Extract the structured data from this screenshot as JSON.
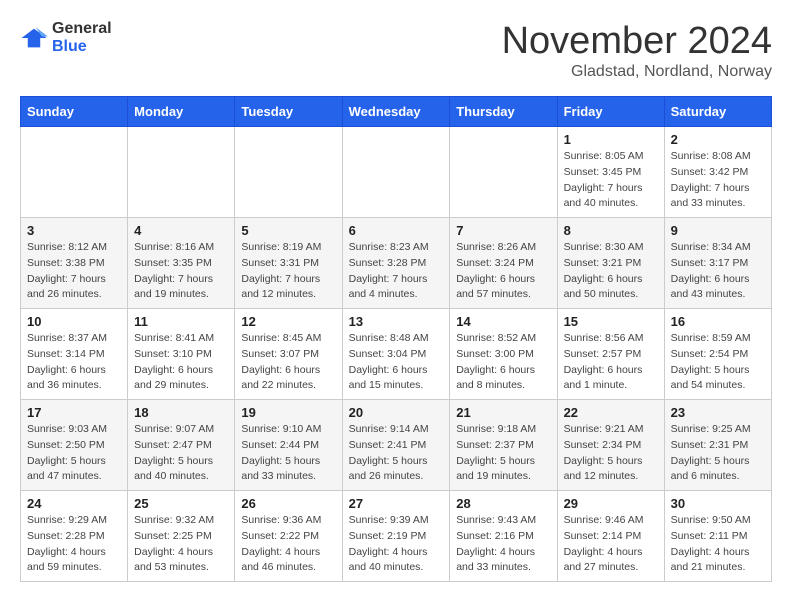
{
  "logo": {
    "text_general": "General",
    "text_blue": "Blue"
  },
  "title": "November 2024",
  "subtitle": "Gladstad, Nordland, Norway",
  "days_of_week": [
    "Sunday",
    "Monday",
    "Tuesday",
    "Wednesday",
    "Thursday",
    "Friday",
    "Saturday"
  ],
  "weeks": [
    [
      {
        "day": "",
        "info": ""
      },
      {
        "day": "",
        "info": ""
      },
      {
        "day": "",
        "info": ""
      },
      {
        "day": "",
        "info": ""
      },
      {
        "day": "",
        "info": ""
      },
      {
        "day": "1",
        "info": "Sunrise: 8:05 AM\nSunset: 3:45 PM\nDaylight: 7 hours and 40 minutes."
      },
      {
        "day": "2",
        "info": "Sunrise: 8:08 AM\nSunset: 3:42 PM\nDaylight: 7 hours and 33 minutes."
      }
    ],
    [
      {
        "day": "3",
        "info": "Sunrise: 8:12 AM\nSunset: 3:38 PM\nDaylight: 7 hours and 26 minutes."
      },
      {
        "day": "4",
        "info": "Sunrise: 8:16 AM\nSunset: 3:35 PM\nDaylight: 7 hours and 19 minutes."
      },
      {
        "day": "5",
        "info": "Sunrise: 8:19 AM\nSunset: 3:31 PM\nDaylight: 7 hours and 12 minutes."
      },
      {
        "day": "6",
        "info": "Sunrise: 8:23 AM\nSunset: 3:28 PM\nDaylight: 7 hours and 4 minutes."
      },
      {
        "day": "7",
        "info": "Sunrise: 8:26 AM\nSunset: 3:24 PM\nDaylight: 6 hours and 57 minutes."
      },
      {
        "day": "8",
        "info": "Sunrise: 8:30 AM\nSunset: 3:21 PM\nDaylight: 6 hours and 50 minutes."
      },
      {
        "day": "9",
        "info": "Sunrise: 8:34 AM\nSunset: 3:17 PM\nDaylight: 6 hours and 43 minutes."
      }
    ],
    [
      {
        "day": "10",
        "info": "Sunrise: 8:37 AM\nSunset: 3:14 PM\nDaylight: 6 hours and 36 minutes."
      },
      {
        "day": "11",
        "info": "Sunrise: 8:41 AM\nSunset: 3:10 PM\nDaylight: 6 hours and 29 minutes."
      },
      {
        "day": "12",
        "info": "Sunrise: 8:45 AM\nSunset: 3:07 PM\nDaylight: 6 hours and 22 minutes."
      },
      {
        "day": "13",
        "info": "Sunrise: 8:48 AM\nSunset: 3:04 PM\nDaylight: 6 hours and 15 minutes."
      },
      {
        "day": "14",
        "info": "Sunrise: 8:52 AM\nSunset: 3:00 PM\nDaylight: 6 hours and 8 minutes."
      },
      {
        "day": "15",
        "info": "Sunrise: 8:56 AM\nSunset: 2:57 PM\nDaylight: 6 hours and 1 minute."
      },
      {
        "day": "16",
        "info": "Sunrise: 8:59 AM\nSunset: 2:54 PM\nDaylight: 5 hours and 54 minutes."
      }
    ],
    [
      {
        "day": "17",
        "info": "Sunrise: 9:03 AM\nSunset: 2:50 PM\nDaylight: 5 hours and 47 minutes."
      },
      {
        "day": "18",
        "info": "Sunrise: 9:07 AM\nSunset: 2:47 PM\nDaylight: 5 hours and 40 minutes."
      },
      {
        "day": "19",
        "info": "Sunrise: 9:10 AM\nSunset: 2:44 PM\nDaylight: 5 hours and 33 minutes."
      },
      {
        "day": "20",
        "info": "Sunrise: 9:14 AM\nSunset: 2:41 PM\nDaylight: 5 hours and 26 minutes."
      },
      {
        "day": "21",
        "info": "Sunrise: 9:18 AM\nSunset: 2:37 PM\nDaylight: 5 hours and 19 minutes."
      },
      {
        "day": "22",
        "info": "Sunrise: 9:21 AM\nSunset: 2:34 PM\nDaylight: 5 hours and 12 minutes."
      },
      {
        "day": "23",
        "info": "Sunrise: 9:25 AM\nSunset: 2:31 PM\nDaylight: 5 hours and 6 minutes."
      }
    ],
    [
      {
        "day": "24",
        "info": "Sunrise: 9:29 AM\nSunset: 2:28 PM\nDaylight: 4 hours and 59 minutes."
      },
      {
        "day": "25",
        "info": "Sunrise: 9:32 AM\nSunset: 2:25 PM\nDaylight: 4 hours and 53 minutes."
      },
      {
        "day": "26",
        "info": "Sunrise: 9:36 AM\nSunset: 2:22 PM\nDaylight: 4 hours and 46 minutes."
      },
      {
        "day": "27",
        "info": "Sunrise: 9:39 AM\nSunset: 2:19 PM\nDaylight: 4 hours and 40 minutes."
      },
      {
        "day": "28",
        "info": "Sunrise: 9:43 AM\nSunset: 2:16 PM\nDaylight: 4 hours and 33 minutes."
      },
      {
        "day": "29",
        "info": "Sunrise: 9:46 AM\nSunset: 2:14 PM\nDaylight: 4 hours and 27 minutes."
      },
      {
        "day": "30",
        "info": "Sunrise: 9:50 AM\nSunset: 2:11 PM\nDaylight: 4 hours and 21 minutes."
      }
    ]
  ]
}
